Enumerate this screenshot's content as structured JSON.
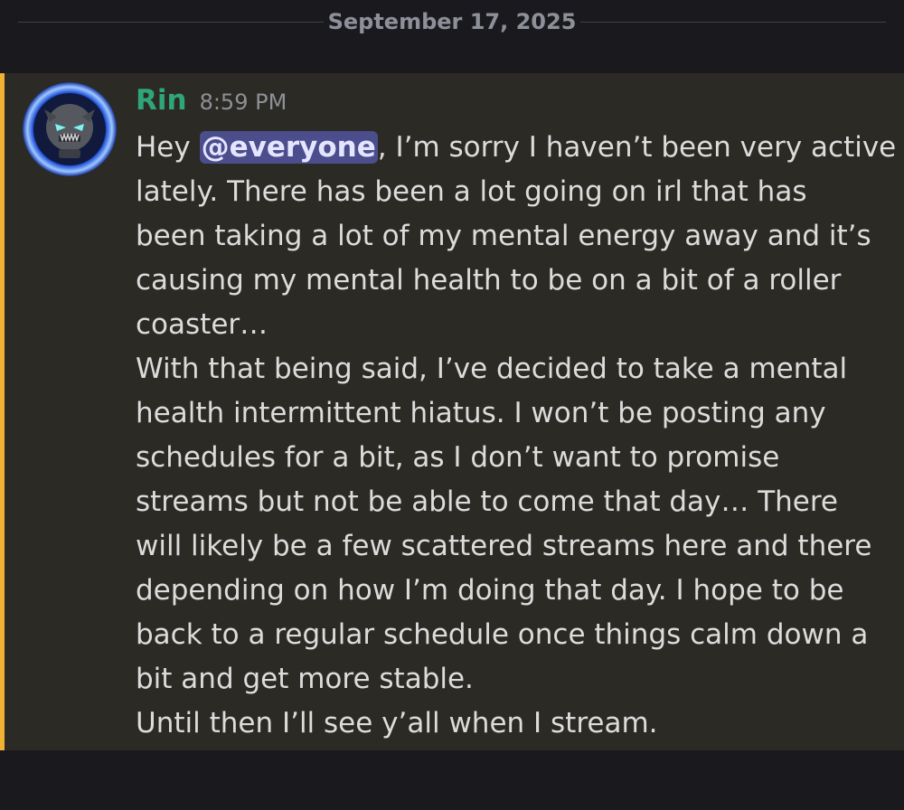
{
  "date_divider": "September 17, 2025",
  "message": {
    "username": "Rin",
    "timestamp": "8:59 PM",
    "mention": "@everyone",
    "first_line_prefix": "Hey ",
    "first_line_suffix": ", I’m sorry I haven’t been very active",
    "lines": [
      "lately. There has been a lot going on irl that has",
      "been taking a lot of my mental energy away and it’s",
      "causing my mental health to be on a bit of a roller",
      "coaster…",
      "With that being said, I’ve decided to take a mental",
      "health intermittent hiatus. I won’t be posting any",
      "schedules for a bit, as I don’t want to promise",
      "streams but not be able to come that day… There",
      "will likely be a few scattered streams here and there",
      "depending on how I’m doing that day. I hope to be",
      "back to a regular schedule once things calm down a",
      "bit and get more stable.",
      "Until then I’ll see y’all when I stream."
    ]
  },
  "colors": {
    "background": "#1a1a1e",
    "message_highlight": "#2c2a24",
    "highlight_bar": "#f0b232",
    "username": "#2ea57a",
    "mention_bg": "#4b4d8c"
  }
}
